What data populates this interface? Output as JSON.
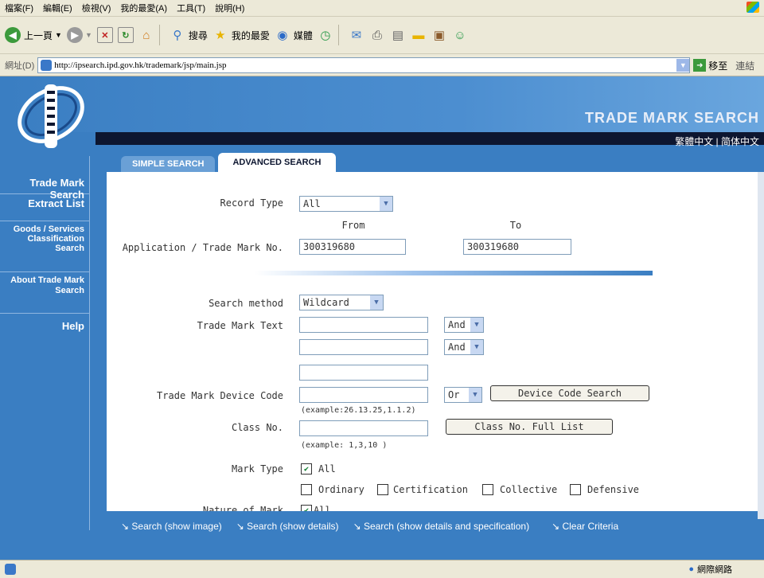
{
  "menu": [
    "檔案(F)",
    "編輯(E)",
    "檢視(V)",
    "我的最愛(A)",
    "工具(T)",
    "說明(H)"
  ],
  "toolbar": {
    "back": "上一頁",
    "search": "搜尋",
    "favorites": "我的最愛",
    "media": "媒體"
  },
  "address": {
    "label": "網址(D)",
    "url": "http://ipsearch.ipd.gov.hk/trademark/jsp/main.jsp",
    "go": "移至",
    "links": "連結"
  },
  "header": {
    "brand": "TRADE MARK SEARCH",
    "lang": "繁體中文 | 简体中文"
  },
  "sidebar": [
    {
      "label": "Trade Mark Search"
    },
    {
      "label": "Extract List"
    },
    {
      "label": "Goods / Services Classification Search"
    },
    {
      "label": "About Trade Mark Search"
    },
    {
      "label": "Help"
    }
  ],
  "tabs": {
    "simple": "SIMPLE SEARCH",
    "advanced": "ADVANCED SEARCH"
  },
  "form": {
    "record_type_label": "Record Type",
    "record_type_value": "All",
    "from_label": "From",
    "to_label": "To",
    "app_no_label": "Application / Trade Mark No.",
    "app_from": "300319680",
    "app_to": "300319680",
    "search_method_label": "Search method",
    "search_method_value": "Wildcard",
    "tm_text_label": "Trade Mark Text",
    "op1": "And",
    "op2": "And",
    "device_label": "Trade Mark Device Code",
    "device_op": "Or",
    "device_btn": "Device Code Search",
    "device_hint": "(example:26.13.25,1.1.2)",
    "class_label": "Class No.",
    "class_btn": "Class No. Full List",
    "class_hint": "(example: 1,3,10 )",
    "mark_type_label": "Mark Type",
    "mark_all": "All",
    "ordinary": "Ordinary",
    "certification": "Certification",
    "collective": "Collective",
    "defensive": "Defensive",
    "nature_label": "Nature of Mark",
    "nature_all": "All"
  },
  "actions": [
    "Search (show image)",
    "Search (show details)",
    "Search (show details and specification)",
    "Clear Criteria"
  ],
  "status": {
    "zone": "網際網路"
  }
}
